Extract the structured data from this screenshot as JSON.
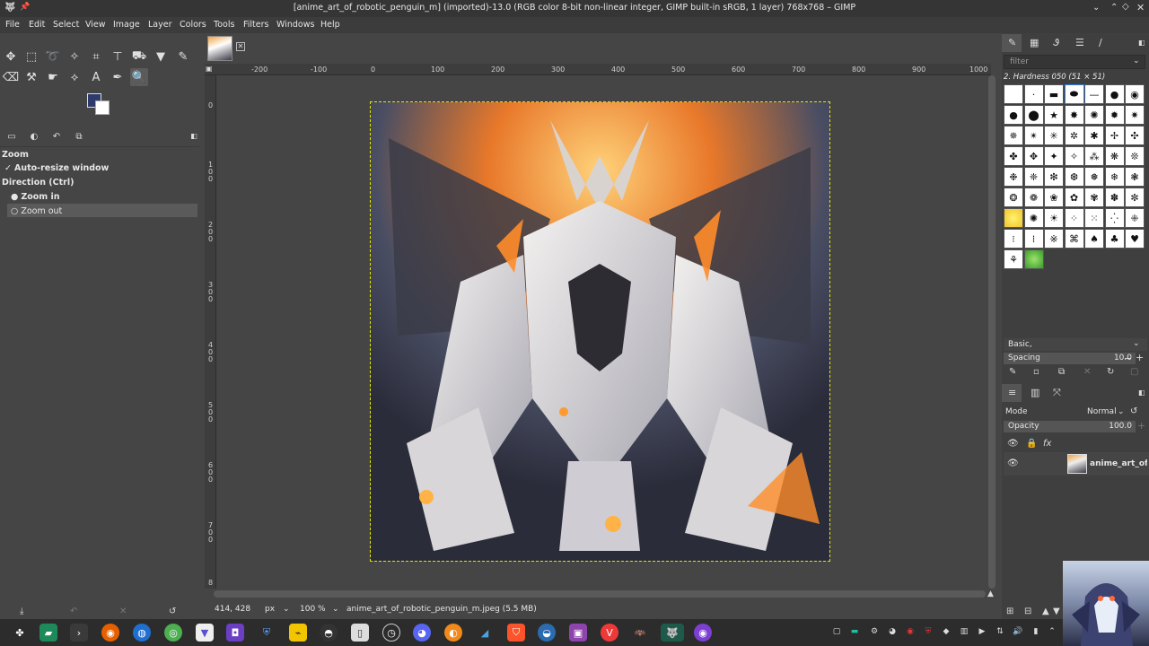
{
  "window": {
    "title": "[anime_art_of_robotic_penguin_m] (imported)-13.0 (RGB color 8-bit non-linear integer, GIMP built-in sRGB, 1 layer) 768x768 – GIMP"
  },
  "menubar": [
    "File",
    "Edit",
    "Select",
    "View",
    "Image",
    "Layer",
    "Colors",
    "Tools",
    "Filters",
    "Windows",
    "Help"
  ],
  "tool_options": {
    "title": "Zoom",
    "auto_resize": "Auto-resize window",
    "direction_label": "Direction  (Ctrl)",
    "zoom_in": "Zoom in",
    "zoom_out": "Zoom out"
  },
  "rulers": {
    "h": [
      "-200",
      "-100",
      "0",
      "100",
      "200",
      "300",
      "400",
      "500",
      "600",
      "700",
      "800",
      "900",
      "1000"
    ],
    "v": [
      "0",
      "1\n0\n0",
      "2\n0\n0",
      "3\n0\n0",
      "4\n0\n0",
      "5\n0\n0",
      "6\n0\n0",
      "7\n0\n0",
      "8"
    ]
  },
  "statusbar": {
    "coords": "414, 428",
    "unit": "px",
    "zoom": "100 %",
    "file": "anime_art_of_robotic_penguin_m.jpeg (5.5 MB)"
  },
  "brushes": {
    "filter_placeholder": "filter",
    "current": "2. Hardness 050 (51 × 51)",
    "preset": "Basic,",
    "spacing_label": "Spacing",
    "spacing_value": "10.0"
  },
  "layers": {
    "mode_label": "Mode",
    "mode_value": "Normal",
    "opacity_label": "Opacity",
    "opacity_value": "100.0",
    "layer_name": "anime_art_of_r"
  },
  "taskbar_icons": [
    "start-icon",
    "files-icon",
    "terminal-icon",
    "firefox-icon",
    "browser-icon",
    "chrome-icon",
    "app-icon",
    "app-icon-2",
    "security-icon",
    "notes-icon",
    "obs-icon",
    "document-icon",
    "clock-icon",
    "discord-icon",
    "blender-icon",
    "remote-icon",
    "brave-icon",
    "vpn-icon",
    "media-icon",
    "vivaldi-icon",
    "batman-icon",
    "gimp-icon",
    "music-icon"
  ]
}
